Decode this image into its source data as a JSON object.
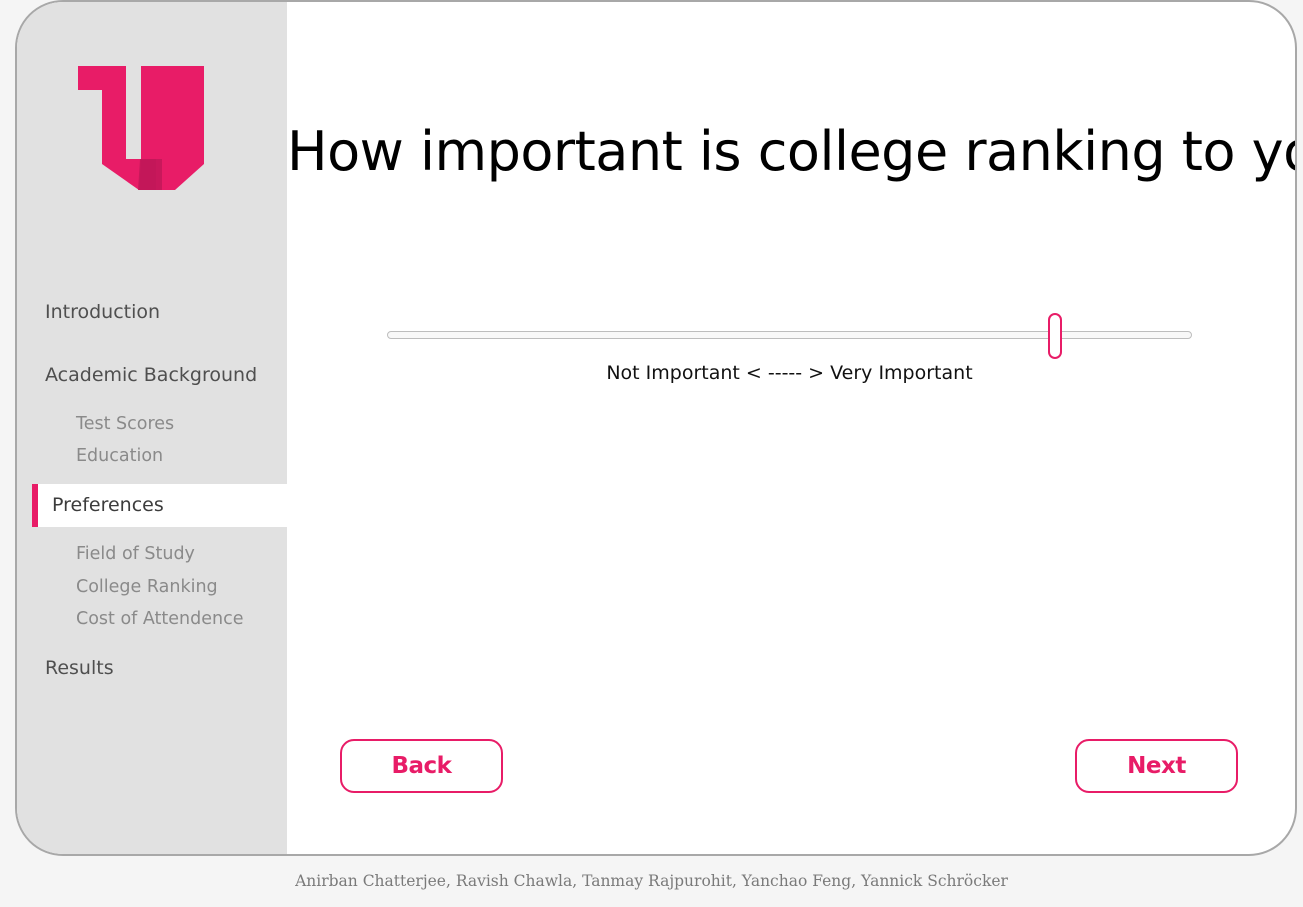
{
  "brand": {
    "accent_color": "#e81c67",
    "logo_icon": "u-logo-icon"
  },
  "sidebar": {
    "items": [
      {
        "label": "Introduction",
        "level": "section",
        "active": false
      },
      {
        "label": "Academic Background",
        "level": "section",
        "active": false
      },
      {
        "label": "Test Scores",
        "level": "subsection",
        "active": false
      },
      {
        "label": "Education",
        "level": "subsection",
        "active": false
      },
      {
        "label": "Preferences",
        "level": "section",
        "active": true
      },
      {
        "label": "Field of Study",
        "level": "subsection",
        "active": false
      },
      {
        "label": "College Ranking",
        "level": "subsection",
        "active": false
      },
      {
        "label": "Cost of Attendence",
        "level": "subsection",
        "active": false
      },
      {
        "label": "Results",
        "level": "section",
        "active": false
      }
    ]
  },
  "main": {
    "question": "How important is college ranking to you?",
    "slider": {
      "value_fraction": 0.83,
      "scale_label": "Not Important < ----- > Very Important"
    },
    "back_label": "Back",
    "next_label": "Next"
  },
  "footer": {
    "credits": "Anirban Chatterjee, Ravish Chawla, Tanmay Rajpurohit, Yanchao Feng, Yannick Schröcker"
  }
}
